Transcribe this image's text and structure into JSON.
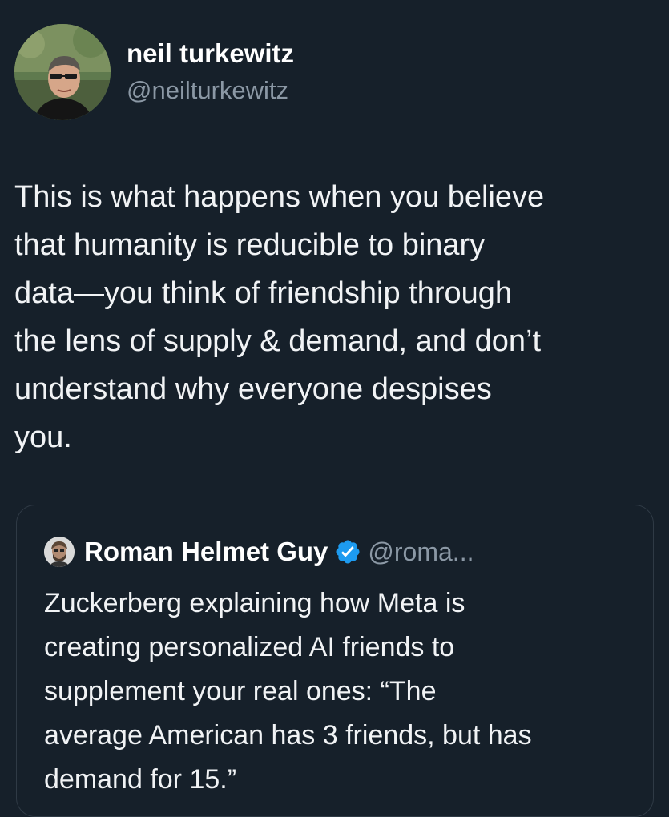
{
  "tweet": {
    "author": {
      "display_name": "neil turkewitz",
      "handle": "@neilturkewitz",
      "avatar_icon": "profile-photo-icon"
    },
    "text": "This is what happens when you believe\nthat humanity is reducible to binary\ndata—you think of friendship through\nthe lens of supply & demand, and don’t\nunderstand why everyone despises\nyou."
  },
  "quote": {
    "author": {
      "display_name": "Roman Helmet Guy",
      "handle": "@roma...",
      "verified_icon": "verified-badge-icon",
      "avatar_icon": "profile-photo-icon"
    },
    "text": "Zuckerberg explaining how Meta is\ncreating personalized AI friends to\nsupplement your real ones: “The\naverage American has 3 friends, but has\ndemand for 15.”"
  },
  "colors": {
    "background": "#16202a",
    "primary_text": "#f1f3f5",
    "secondary_text": "#8b98a5",
    "verified_blue": "#1d9bf0",
    "card_border": "#2f3a45"
  }
}
